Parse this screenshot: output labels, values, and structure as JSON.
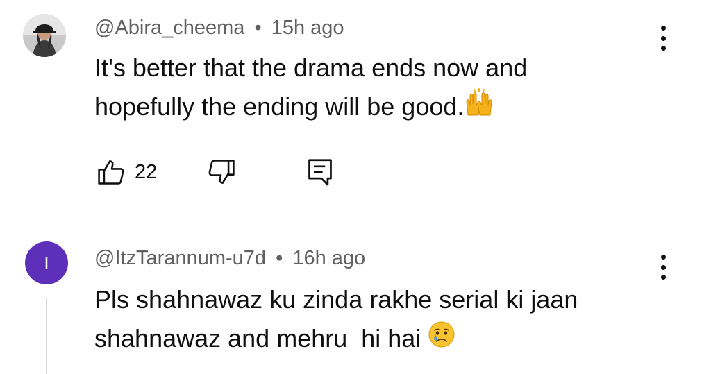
{
  "comments": [
    {
      "handle": "@Abira_cheema",
      "separator": "•",
      "time": "15h ago",
      "line1": "It's better that the drama ends now and",
      "line2": "hopefully the ending will be good.",
      "emoji": "raising-hands",
      "likes": "22",
      "avatar": "photo"
    },
    {
      "handle": "@ItzTarannum-u7d",
      "separator": "•",
      "time": "16h ago",
      "line1": "Pls shahnawaz ku zinda rakhe serial ki jaan",
      "line2": "shahnawaz and mehru  hi hai",
      "emoji": "crying-face",
      "avatar_letter": "I",
      "avatar_color": "#5e2fb8"
    }
  ],
  "icons": {
    "like": "thumbs-up-icon",
    "dislike": "thumbs-down-icon",
    "reply": "reply-icon",
    "more": "more-vertical-icon"
  }
}
